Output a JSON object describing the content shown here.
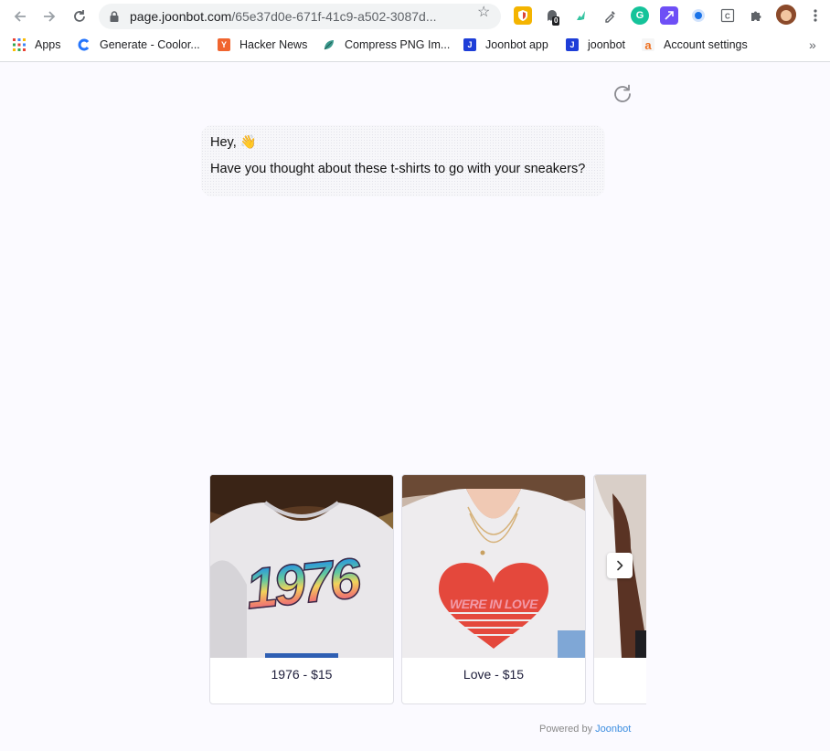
{
  "browser": {
    "url_host": "page.joonbot.com",
    "url_path": "/65e37d0e-671f-41c9-a502-3087d...",
    "bookmarks": [
      {
        "label": "Apps",
        "icon": "apps-grid-icon"
      },
      {
        "label": "Generate - Coolor...",
        "icon": "coolors-icon"
      },
      {
        "label": "Hacker News",
        "icon": "hacker-news-icon"
      },
      {
        "label": "Compress PNG Im...",
        "icon": "tinypng-icon"
      },
      {
        "label": "Joonbot app",
        "icon": "joonbot-icon"
      },
      {
        "label": "joonbot",
        "icon": "joonbot-icon"
      },
      {
        "label": "Account settings",
        "icon": "account-settings-icon"
      }
    ],
    "extension_badge": "0",
    "more_bookmarks": "»"
  },
  "chat": {
    "greeting": "Hey, 👋",
    "message": "Have you thought about these t-shirts to go with your sneakers?"
  },
  "products": [
    {
      "caption": "1976 - $15",
      "print_text": "1976"
    },
    {
      "caption": "Love - $15",
      "print_text": "WERE IN LOVE"
    },
    {
      "caption": ""
    }
  ],
  "footer": {
    "powered_by": "Powered by",
    "brand": "Joonbot"
  },
  "colors": {
    "accent": "#3a8de0",
    "page_bg": "#fbfaff"
  }
}
